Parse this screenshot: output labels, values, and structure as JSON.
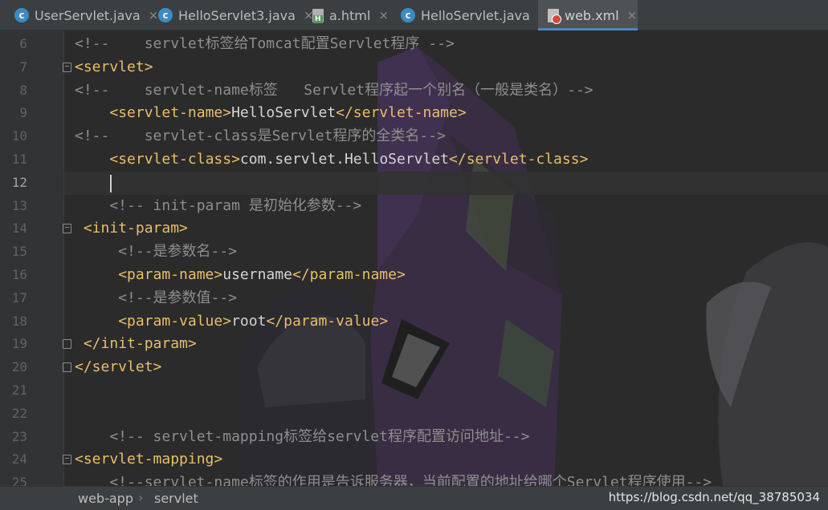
{
  "tabs": [
    {
      "label": "UserServlet.java",
      "icon": "java-class-icon",
      "active": false
    },
    {
      "label": "HelloServlet3.java",
      "icon": "java-class-icon",
      "active": false
    },
    {
      "label": "a.html",
      "icon": "html-file-icon",
      "active": false
    },
    {
      "label": "HelloServlet.java",
      "icon": "java-class-icon",
      "active": false
    },
    {
      "label": "web.xml",
      "icon": "xml-file-icon",
      "active": true
    }
  ],
  "tab_close_glyph": "×",
  "icon_letter": "c",
  "editor": {
    "current_line": 12,
    "lines": [
      {
        "n": "6",
        "seg": [
          {
            "t": "<!--    servlet标签给Tomcat配置Servlet程序 -->",
            "c": "cm"
          }
        ]
      },
      {
        "n": "7",
        "seg": [
          {
            "t": "<servlet>",
            "c": "tg"
          }
        ]
      },
      {
        "n": "8",
        "seg": [
          {
            "t": "<!--    servlet-name标签   Servlet程序起一个别名（一般是类名）-->",
            "c": "cm"
          }
        ]
      },
      {
        "n": "9",
        "seg": [
          {
            "t": "    ",
            "c": "tx"
          },
          {
            "t": "<servlet-name>",
            "c": "tg"
          },
          {
            "t": "HelloServlet",
            "c": "tx"
          },
          {
            "t": "</servlet-name>",
            "c": "tg"
          }
        ]
      },
      {
        "n": "10",
        "seg": [
          {
            "t": "<!--    servlet-class是Servlet程序的全类名-->",
            "c": "cm"
          }
        ]
      },
      {
        "n": "11",
        "seg": [
          {
            "t": "    ",
            "c": "tx"
          },
          {
            "t": "<servlet-class>",
            "c": "tg"
          },
          {
            "t": "com.servlet.HelloServlet",
            "c": "tx"
          },
          {
            "t": "</servlet-class>",
            "c": "tg"
          }
        ]
      },
      {
        "n": "12",
        "seg": []
      },
      {
        "n": "13",
        "seg": [
          {
            "t": "    <!-- init-param 是初始化参数-->",
            "c": "cm"
          }
        ]
      },
      {
        "n": "14",
        "seg": [
          {
            "t": " ",
            "c": "tx"
          },
          {
            "t": "<init-param>",
            "c": "tg"
          }
        ]
      },
      {
        "n": "15",
        "seg": [
          {
            "t": "     <!--是参数名-->",
            "c": "cm"
          }
        ]
      },
      {
        "n": "16",
        "seg": [
          {
            "t": "     ",
            "c": "tx"
          },
          {
            "t": "<param-name>",
            "c": "tg"
          },
          {
            "t": "username",
            "c": "tx"
          },
          {
            "t": "</param-name>",
            "c": "tg"
          }
        ]
      },
      {
        "n": "17",
        "seg": [
          {
            "t": "     <!--是参数值-->",
            "c": "cm"
          }
        ]
      },
      {
        "n": "18",
        "seg": [
          {
            "t": "     ",
            "c": "tx"
          },
          {
            "t": "<param-value>",
            "c": "tg"
          },
          {
            "t": "root",
            "c": "tx"
          },
          {
            "t": "</param-value>",
            "c": "tg"
          }
        ]
      },
      {
        "n": "19",
        "seg": [
          {
            "t": " ",
            "c": "tx"
          },
          {
            "t": "</init-param>",
            "c": "tg"
          }
        ]
      },
      {
        "n": "20",
        "seg": [
          {
            "t": "</servlet>",
            "c": "tg"
          }
        ]
      },
      {
        "n": "21",
        "seg": []
      },
      {
        "n": "22",
        "seg": []
      },
      {
        "n": "23",
        "seg": [
          {
            "t": "    <!-- servlet-mapping标签给servlet程序配置访问地址-->",
            "c": "cm"
          }
        ]
      },
      {
        "n": "24",
        "seg": [
          {
            "t": "<servlet-mapping>",
            "c": "tg"
          }
        ]
      },
      {
        "n": "25",
        "seg": [
          {
            "t": "    <!--servlet-name标签的作用是告诉服务器，当前配置的地址给哪个Servlet程序使用-->",
            "c": "cm"
          }
        ]
      }
    ]
  },
  "breadcrumb": [
    "web-app",
    "servlet"
  ],
  "breadcrumb_separator": "›",
  "watermark": "https://blog.csdn.net/qq_38785034",
  "colors": {
    "editor_bg": "#2b2b2b",
    "tag": "#e8bf6a",
    "comment": "#8e8e8e",
    "text": "#d4d4d4",
    "tab_accent": "#4a88c7"
  }
}
